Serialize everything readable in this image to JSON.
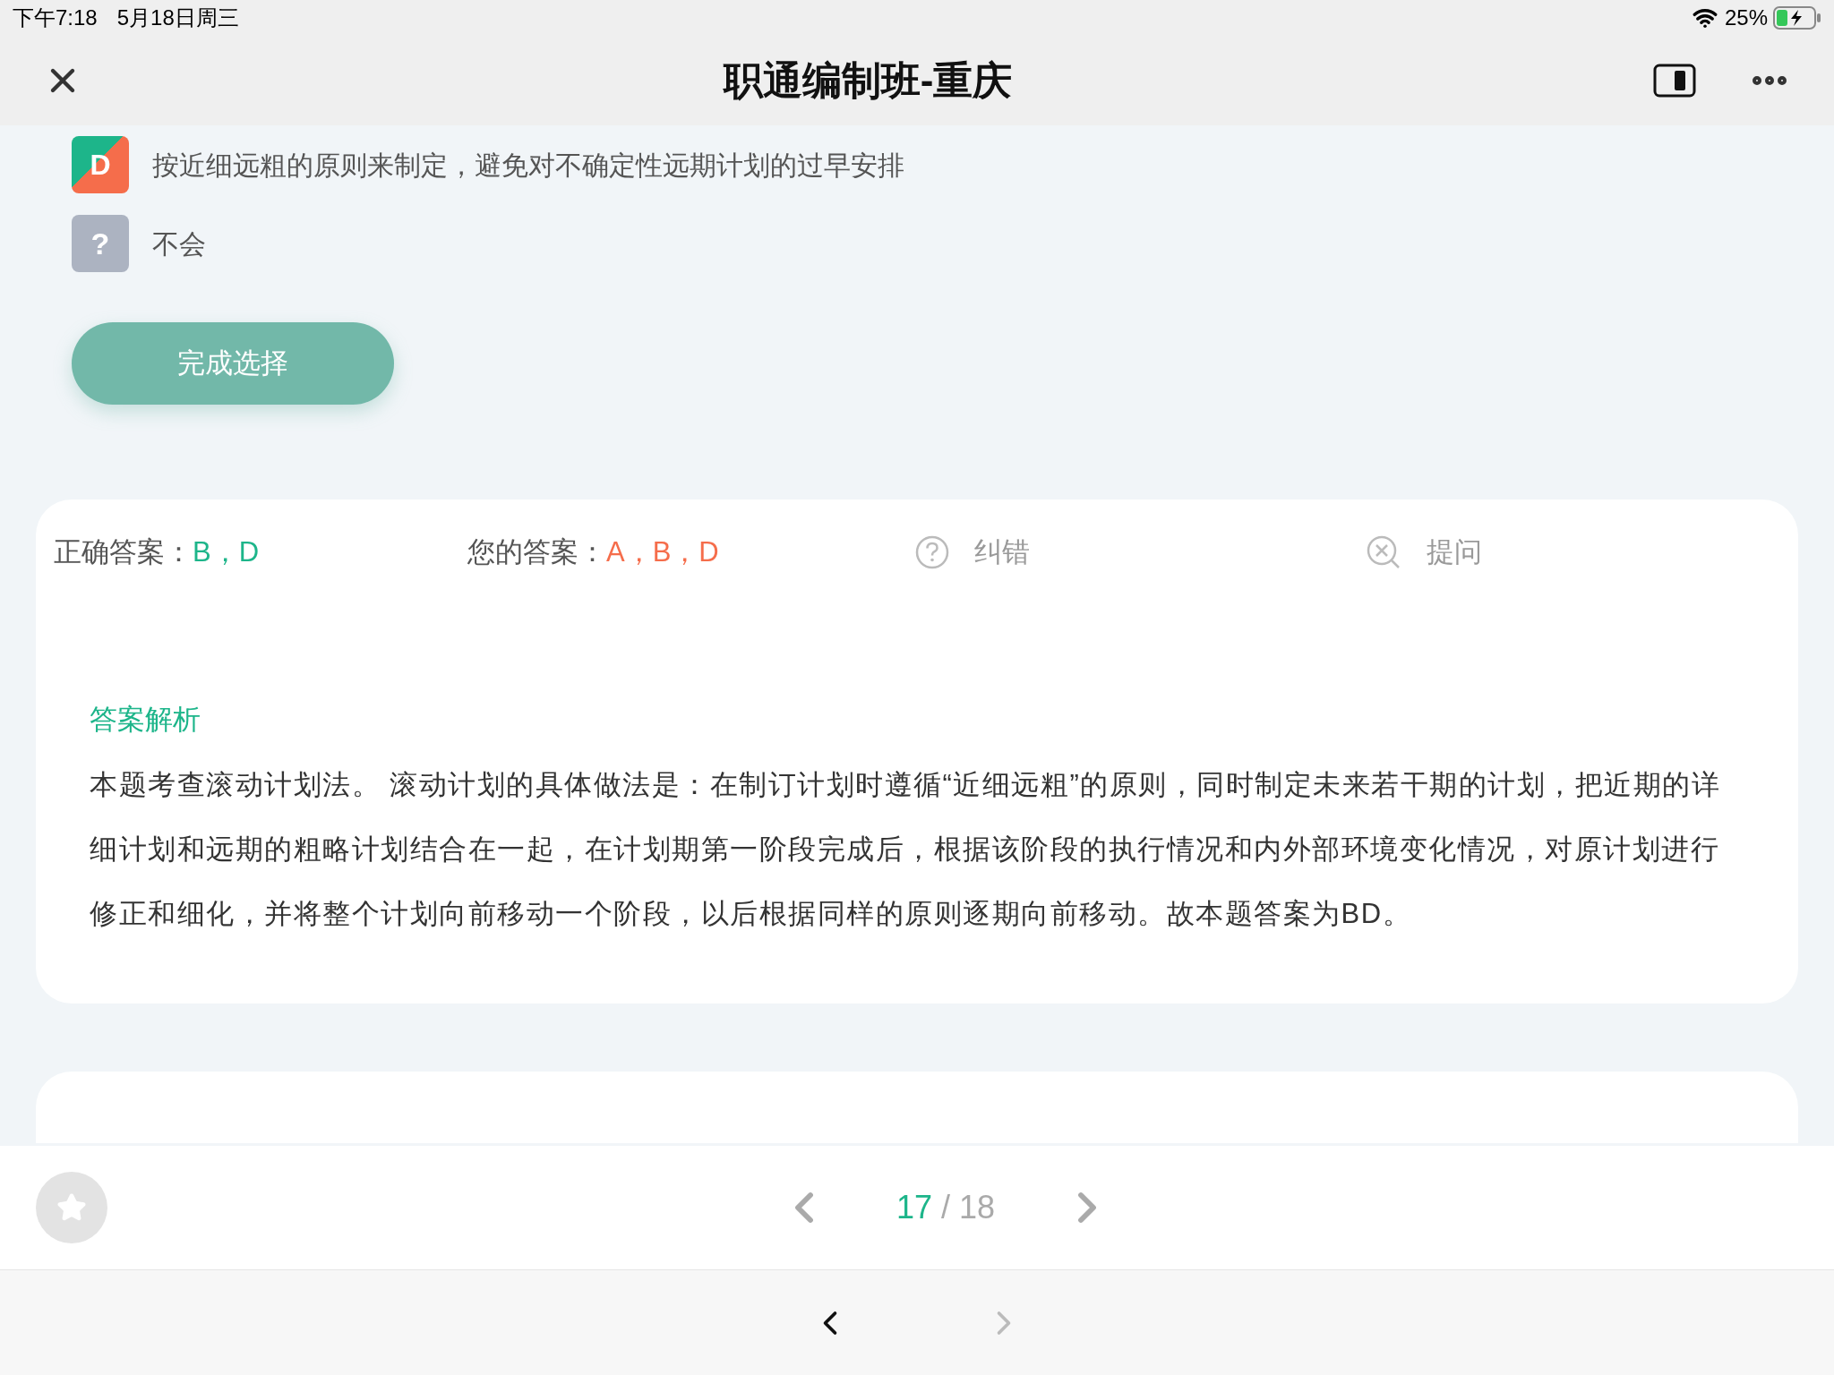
{
  "status_bar": {
    "time": "下午7:18",
    "date": "5月18日周三",
    "battery": "25%"
  },
  "header": {
    "title": "职通编制班-重庆"
  },
  "options": [
    {
      "label": "D",
      "kind": "letter",
      "text": "按近细远粗的原则来制定，避免对不确定性远期计划的过早安排"
    },
    {
      "label": "?",
      "kind": "unknown",
      "text": "不会"
    }
  ],
  "submit_button": "完成选择",
  "answer": {
    "correct_label": "正确答案：",
    "correct": "B，D",
    "yours_label": "您的答案：",
    "yours": "A，B，D",
    "report": "纠错",
    "ask": "提问"
  },
  "analysis": {
    "title": "答案解析",
    "text": "本题考查滚动计划法。 滚动计划的具体做法是：在制订计划时遵循“近细远粗”的原则，同时制定未来若干期的计划，把近期的详细计划和远期的粗略计划结合在一起，在计划期第一阶段完成后，根据该阶段的执行情况和内外部环境变化情况，对原计划进行修正和细化，并将整个计划向前移动一个阶段，以后根据同样的原则逐期向前移动。故本题答案为BD。"
  },
  "pager": {
    "current": "17",
    "separator": "/",
    "total": "18",
    "favorited": false
  },
  "browser_nav": {
    "back_disabled": false,
    "forward_disabled": true
  }
}
